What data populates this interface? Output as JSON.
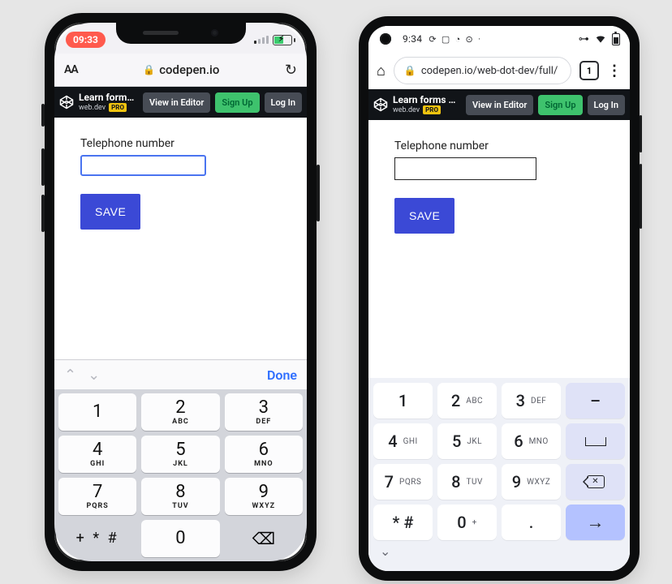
{
  "iphone": {
    "status": {
      "time": "09:33"
    },
    "safari": {
      "aa": "AA",
      "lock": "🔒",
      "domain": "codepen.io",
      "reload": "↻"
    },
    "codepen": {
      "title": "Learn forms – virt…",
      "author": "web.dev",
      "pro": "PRO",
      "view": "View in Editor",
      "signup": "Sign Up",
      "login": "Log In"
    },
    "form": {
      "label": "Telephone number",
      "value": "",
      "save": "SAVE"
    },
    "accessory": {
      "up": "⌃",
      "down": "⌄",
      "done": "Done"
    },
    "keypad": {
      "keys": [
        {
          "num": "1",
          "letters": ""
        },
        {
          "num": "2",
          "letters": "ABC"
        },
        {
          "num": "3",
          "letters": "DEF"
        },
        {
          "num": "4",
          "letters": "GHI"
        },
        {
          "num": "5",
          "letters": "JKL"
        },
        {
          "num": "6",
          "letters": "MNO"
        },
        {
          "num": "7",
          "letters": "PQRS"
        },
        {
          "num": "8",
          "letters": "TUV"
        },
        {
          "num": "9",
          "letters": "WXYZ"
        }
      ],
      "sym": "+ * #",
      "zero": "0",
      "backspace": "⌫"
    }
  },
  "pixel": {
    "status": {
      "time": "9:34",
      "left_icons": [
        "⟳",
        "▢",
        "◔",
        "⊙",
        "·"
      ],
      "right_icons": {
        "vpn": "⊶"
      }
    },
    "chrome": {
      "home": "⌂",
      "lock": "🔒",
      "url": "codepen.io/web-dot-dev/full/",
      "tab_count": "1",
      "more": "⋮"
    },
    "codepen": {
      "title": "Learn forms – virt…",
      "author": "web.dev",
      "pro": "PRO",
      "view": "View in Editor",
      "signup": "Sign Up",
      "login": "Log In"
    },
    "form": {
      "label": "Telephone number",
      "value": "",
      "save": "SAVE"
    },
    "keypad": {
      "rows": [
        [
          {
            "n": "1",
            "l": ""
          },
          {
            "n": "2",
            "l": "ABC"
          },
          {
            "n": "3",
            "l": "DEF"
          },
          {
            "alt": true,
            "sym": "–"
          }
        ],
        [
          {
            "n": "4",
            "l": "GHI"
          },
          {
            "n": "5",
            "l": "JKL"
          },
          {
            "n": "6",
            "l": "MNO"
          },
          {
            "alt": true,
            "sym": "space"
          }
        ],
        [
          {
            "n": "7",
            "l": "PQRS"
          },
          {
            "n": "8",
            "l": "TUV"
          },
          {
            "n": "9",
            "l": "WXYZ"
          },
          {
            "alt": true,
            "sym": "bksp"
          }
        ],
        [
          {
            "n": "* #",
            "l": "",
            "sym_key": true
          },
          {
            "n": "0",
            "l": "+"
          },
          {
            "n": ".",
            "l": ""
          },
          {
            "action": true,
            "sym": "→"
          }
        ]
      ]
    },
    "handle": {
      "chev": "⌄"
    }
  }
}
